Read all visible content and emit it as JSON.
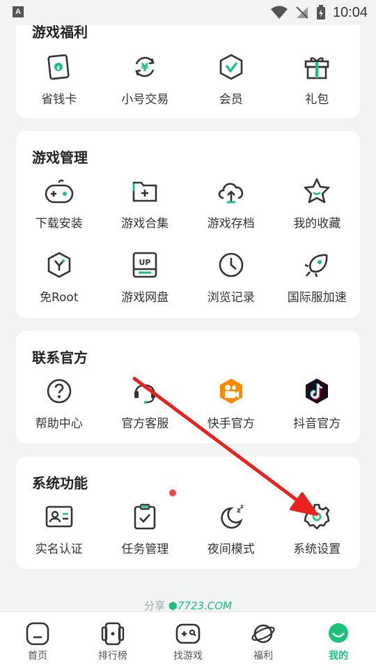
{
  "status_bar": {
    "time": "10:04",
    "app_letter": "A"
  },
  "sections": {
    "welfare": {
      "title": "游戏福利",
      "items": [
        {
          "label": "省钱卡",
          "icon": "savings-card-icon"
        },
        {
          "label": "小号交易",
          "icon": "yuan-exchange-icon"
        },
        {
          "label": "会员",
          "icon": "vip-shield-icon"
        },
        {
          "label": "礼包",
          "icon": "gift-icon"
        }
      ]
    },
    "management": {
      "title": "游戏管理",
      "items": [
        {
          "label": "下载安装",
          "icon": "gamepad-icon"
        },
        {
          "label": "游戏合集",
          "icon": "folder-add-icon"
        },
        {
          "label": "游戏存档",
          "icon": "cloud-upload-icon"
        },
        {
          "label": "我的收藏",
          "icon": "star-icon"
        },
        {
          "label": "免Root",
          "icon": "hexagon-y-icon"
        },
        {
          "label": "游戏网盘",
          "icon": "cloud-drive-icon",
          "badge": "UP"
        },
        {
          "label": "浏览记录",
          "icon": "clock-icon"
        },
        {
          "label": "国际服加速",
          "icon": "rocket-icon"
        }
      ]
    },
    "official": {
      "title": "联系官方",
      "items": [
        {
          "label": "帮助中心",
          "icon": "help-icon"
        },
        {
          "label": "官方客服",
          "icon": "headset-icon"
        },
        {
          "label": "快手官方",
          "icon": "kuaishou-icon"
        },
        {
          "label": "抖音官方",
          "icon": "douyin-icon"
        }
      ]
    },
    "system": {
      "title": "系统功能",
      "items": [
        {
          "label": "实名认证",
          "icon": "id-card-icon"
        },
        {
          "label": "任务管理",
          "icon": "clipboard-check-icon"
        },
        {
          "label": "夜间模式",
          "icon": "moon-icon"
        },
        {
          "label": "系统设置",
          "icon": "gear-icon"
        }
      ]
    }
  },
  "footer": {
    "share": "分享",
    "brand": "7723.COM"
  },
  "bottom_nav": [
    {
      "label": "首页",
      "icon": "home-icon",
      "active": false
    },
    {
      "label": "排行榜",
      "icon": "ranking-icon",
      "active": false
    },
    {
      "label": "找游戏",
      "icon": "find-game-icon",
      "active": false
    },
    {
      "label": "福利",
      "icon": "planet-icon",
      "active": false
    },
    {
      "label": "我的",
      "icon": "profile-icon",
      "active": true
    }
  ],
  "colors": {
    "accent": "#19c27d",
    "annotation": "#e8231f",
    "kuaishou": "#ff8a00",
    "douyin": "#1c0b1d"
  }
}
